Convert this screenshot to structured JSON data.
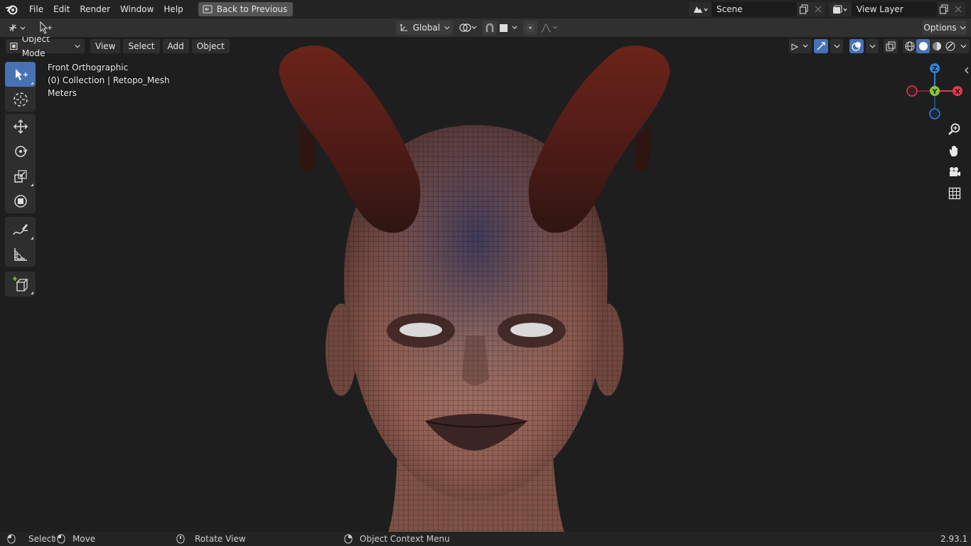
{
  "menu": {
    "items": [
      "File",
      "Edit",
      "Render",
      "Window",
      "Help"
    ],
    "back_button": "Back to Previous"
  },
  "scene": {
    "label": "Scene",
    "view_layer": "View Layer"
  },
  "header": {
    "transform_orientation": "Global",
    "options_label": "Options"
  },
  "viewport_header": {
    "mode": "Object Mode",
    "menus": [
      "View",
      "Select",
      "Add",
      "Object"
    ]
  },
  "overlay": {
    "view_name": "Front Orthographic",
    "collection_info": "(0) Collection | Retopo_Mesh",
    "units": "Meters"
  },
  "gizmo": {
    "z": "Z",
    "y": "Y",
    "x": "X"
  },
  "tools": [
    "select-box-icon",
    "cursor-icon",
    "move-icon",
    "rotate-icon",
    "scale-icon",
    "transform-icon",
    "annotate-icon",
    "measure-icon",
    "add-cube-icon"
  ],
  "nav_icons": [
    "zoom-icon",
    "hand-pan-icon",
    "camera-icon",
    "grid-icon"
  ],
  "status": {
    "select": "Select",
    "move": "Move",
    "rotate": "Rotate View",
    "context": "Object Context Menu",
    "version": "2.93.1"
  },
  "colors": {
    "accent": "#4772b3",
    "axis_x": "#e23a4f",
    "axis_y": "#8bc43d",
    "axis_z": "#2f83d8"
  }
}
